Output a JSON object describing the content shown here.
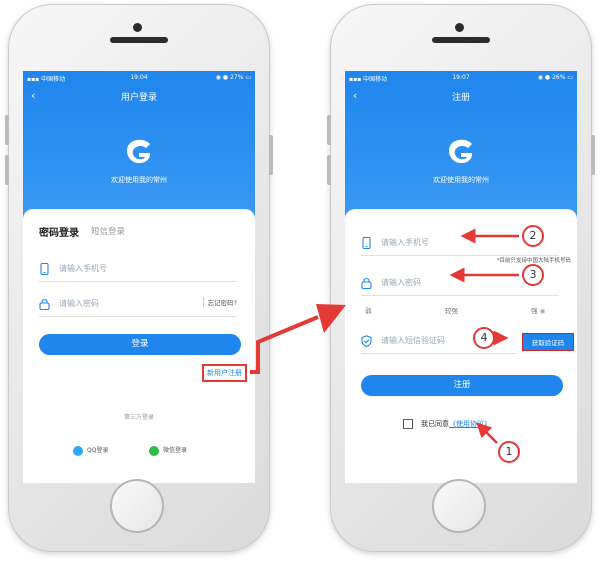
{
  "colors": {
    "accent": "#1f86ee",
    "annotation": "#e53935"
  },
  "login_phone": {
    "status": {
      "carrier": "中国移动",
      "time": "19:04",
      "battery": "27%"
    },
    "nav_title": "用户登录",
    "back_icon": "chevron-left-icon",
    "welcome": "欢迎使用我的常州",
    "tabs": {
      "active": "密码登录",
      "inactive": "短信登录"
    },
    "phone_placeholder": "请输入手机号",
    "password_placeholder": "请输入密码",
    "forgot_password": "忘记密码?",
    "login_button": "登录",
    "new_user_register": "新用户注册",
    "third_party_title": "第三方登录",
    "qq_login": "QQ登录",
    "wechat_login": "微信登录"
  },
  "register_phone": {
    "status": {
      "carrier": "中国移动",
      "time": "19:07",
      "battery": "26%"
    },
    "nav_title": "注册",
    "back_icon": "chevron-left-icon",
    "welcome": "欢迎使用我的常州",
    "phone_placeholder": "请输入手机号",
    "phone_hint": "*目前只支持中国大陆手机号码",
    "password_placeholder": "请输入密码",
    "strength": {
      "weak": "弱",
      "medium": "较强",
      "strong": "强"
    },
    "code_placeholder": "请输入短信验证码",
    "get_code_button": "获取验证码",
    "register_button": "注册",
    "agree_prefix": "我已同意",
    "agree_link": "《使用协议》"
  },
  "callouts": {
    "one": "1",
    "two": "2",
    "three": "3",
    "four": "4"
  }
}
